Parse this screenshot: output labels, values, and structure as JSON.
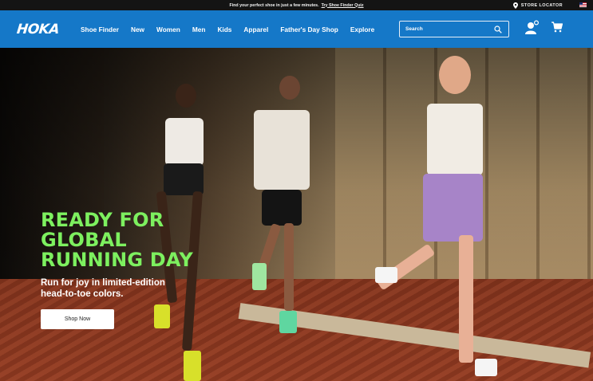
{
  "promo": {
    "text": "Find your perfect shoe in just a few minutes.",
    "link_label": "Try Shoe Finder Quiz",
    "store_locator_label": "STORE LOCATOR",
    "pin_icon": "map-pin-icon",
    "flag_icon": "us-flag-icon"
  },
  "header": {
    "logo_text": "HOKA",
    "nav": [
      "Shoe Finder",
      "New",
      "Women",
      "Men",
      "Kids",
      "Apparel",
      "Father's Day Shop",
      "Explore"
    ],
    "search": {
      "placeholder": "Search",
      "icon": "search-icon"
    },
    "account_icon": "account-icon",
    "cart_icon": "cart-icon"
  },
  "hero": {
    "heading_lines": [
      "READY FOR",
      "GLOBAL",
      "RUNNING DAY"
    ],
    "subtitle_lines": [
      "Run for joy in limited-edition",
      "head-to-toe colors."
    ],
    "cta_label": "Shop Now"
  },
  "colors": {
    "nav_bg": "#1578c8",
    "promo_bg": "#141414",
    "heading_green": "#7df05f"
  }
}
